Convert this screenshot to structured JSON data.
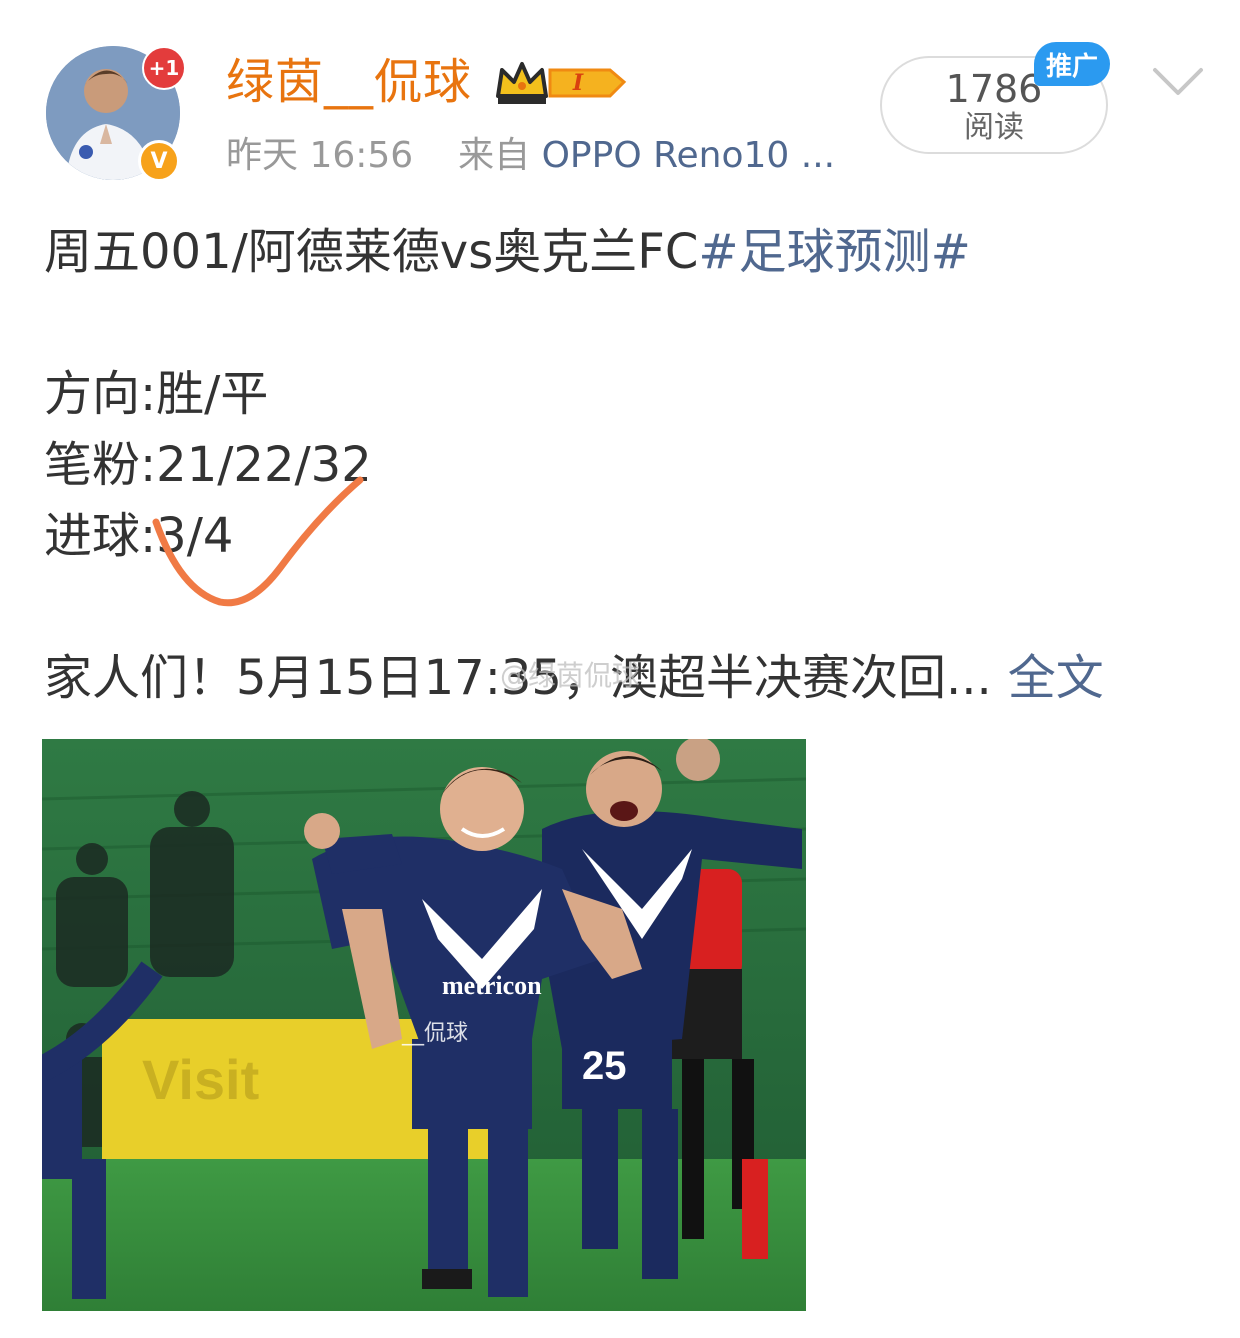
{
  "post": {
    "author": {
      "name": "绿茵__侃球",
      "avatar_badge": "+1",
      "verified_mark": "V",
      "level_badge": "I"
    },
    "meta": {
      "time": "昨天 16:56",
      "source_prefix": "来自",
      "source": "OPPO Reno10 ..."
    },
    "reads": {
      "count": "1786",
      "label": "阅读",
      "promo_tag": "推广"
    },
    "content": {
      "title_plain": "周五001/阿德莱德vs奥克兰FC",
      "title_tag": "#足球预测#",
      "direction": "方向:胜/平",
      "scores": "笔粉:21/22/32",
      "goals": "进球:3/4",
      "intro": "家人们！5月15日17:35，澳超半决赛次回...",
      "expand_link": "全文",
      "overlay_watermark": "@绿茵侃球"
    },
    "image": {
      "watermark": "__侃球",
      "jersey_sponsor": "metricon",
      "jersey_number": "25",
      "banner_text": "Visit"
    }
  },
  "colors": {
    "author_name": "#e8740f",
    "link": "#50688f",
    "check_mark": "#f07a45",
    "promo_tag": "#2b9af0",
    "avatar_badge": "#e33c3c",
    "verified": "#f7a21b"
  }
}
